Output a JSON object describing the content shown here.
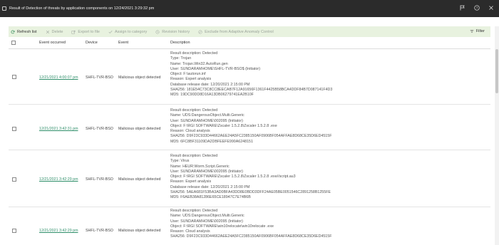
{
  "window": {
    "title": "Result of Detection of threats by application components on 12/24/2021 3:29:32 pm",
    "controls": [
      "flag-icon",
      "help-icon",
      "close-icon"
    ]
  },
  "toolbar": {
    "refresh": "Refresh list",
    "delete": "Delete",
    "export": "Export to file",
    "assign": "Assign to category",
    "revision": "Revision history",
    "exclude": "Exclude from Adaptive Anomaly Control",
    "filter": "Filter"
  },
  "columns": {
    "event_occurred": "Event occurred",
    "device": "Device",
    "event": "Event",
    "description": "Description"
  },
  "rows": [
    {
      "date": "12/21/2021 4:00:07 pm",
      "device": "SHFL-TVR-BSO",
      "event": "Malicious object detected",
      "desc": [
        "Result description: Detected",
        "Type: Trojan",
        "Name: Trojan.Win32.AutoRun.gen",
        "User: SUNDARAMHOME\\SHFL-TVR-BSO$ (Initiator)",
        "Object: F:\\autorun.inf",
        "Reason: Expert analysis",
        "Database release date: 12/20/2021 2:15:00 PM",
        "SHA256: 181E54C73C8CC8EECAB7F12A91656F1361F4425B58BCA4DDF84B7D087141F4D3",
        "MD5: 19DC90DD8D16A13DB06279741EA2B10F"
      ]
    },
    {
      "date": "12/21/2021 3:42:31 pm",
      "device": "SHFL-TVR-BSO",
      "event": "Malicious object detected",
      "desc": [
        "Result description: Detected",
        "Name: UDS:DangerousObject.Multi.Generic",
        "User: SUNDARAMHOME\\002095 (Initiator)",
        "Object: F:\\RGI SOFTWARE\\Zscaler 1.5.2.8\\Zscaler 1.5.2.8 .exe",
        "Reason: Cloud analysis",
        "SHA256: D9F23C933D44662AEE24A5FC2385150AF0906BF054AFFAE8D68CE35D6ED4515F",
        "MD5: 6FC8BF31109DA2DBFEEFE990A6248151"
      ]
    },
    {
      "date": "12/21/2021 3:42:29 pm",
      "device": "SHFL-TVR-BSO",
      "event": "Malicious object detected",
      "desc": [
        "Result description: Detected",
        "Type: Virus",
        "Name: HEUR:Worm.Script.Generic",
        "User: SUNDARAMHOME\\002095 (Initiator)",
        "Object: F:\\RGI SOFTWARE\\Zscaler 1.5.2.8\\Zscaler 1.5.2.8 .exe//script.au3",
        "Reason: Expert analysis",
        "Database release date: 12/20/2021 2:15:00 PM",
        "SHA256: 5AEA681F53BA3AD0BFA43DD8E0BDD3DFF24AE05BE0051546C2891258B1255FE",
        "MD5: F6AEB38A81286E65CE18947C7E74B6B"
      ]
    },
    {
      "date": "12/21/2021 3:42:29 pm",
      "device": "SHFL-TVR-BSO",
      "event": "Malicious object detected",
      "desc": [
        "Result description: Detected",
        "Name: UDS:DangerousObject.Multi.Generic",
        "User: SUNDARAMHOME\\002095 (Initiator)",
        "Object: F:\\RGI SOFTWARE\\win10relocate\\win10relocate .exe",
        "Reason: Cloud analysis",
        "SHA256: D9F23C933D44662AEE24A5FC2385150AF0906BF054AFFAE8D68CE35D6ED4515F"
      ]
    }
  ]
}
